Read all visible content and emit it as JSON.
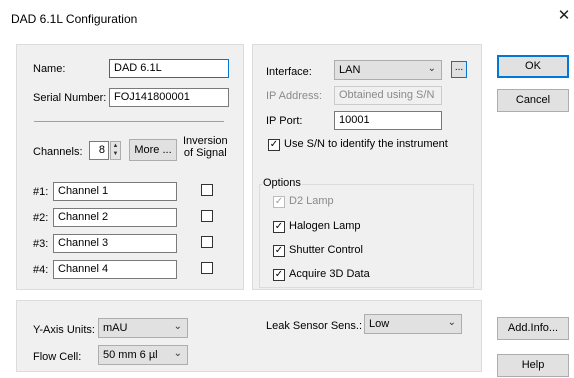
{
  "window": {
    "title": "DAD 6.1L Configuration"
  },
  "general": {
    "name_label": "Name:",
    "name_value": "DAD 6.1L",
    "serial_label": "Serial Number:",
    "serial_value": "FOJ141800001",
    "channels_label": "Channels:",
    "channels_value": "8",
    "more_button": "More ...",
    "inversion_header_line1": "Inversion",
    "inversion_header_line2": "of Signal",
    "channels": [
      {
        "label": "#1:",
        "value": "Channel 1",
        "inverted": false
      },
      {
        "label": "#2:",
        "value": "Channel 2",
        "inverted": false
      },
      {
        "label": "#3:",
        "value": "Channel 3",
        "inverted": false
      },
      {
        "label": "#4:",
        "value": "Channel 4",
        "inverted": false
      }
    ]
  },
  "connection": {
    "interface_label": "Interface:",
    "interface_value": "LAN",
    "browse_button": "...",
    "ip_address_label": "IP Address:",
    "ip_address_value": "Obtained using S/N",
    "ip_port_label": "IP Port:",
    "ip_port_value": "10001",
    "use_sn_label": "Use S/N to identify the instrument",
    "use_sn_checked": true
  },
  "options": {
    "group_label": "Options",
    "items": [
      {
        "label": "D2 Lamp",
        "checked": true,
        "enabled": false
      },
      {
        "label": "Halogen Lamp",
        "checked": true,
        "enabled": true
      },
      {
        "label": "Shutter Control",
        "checked": true,
        "enabled": true
      },
      {
        "label": "Acquire 3D Data",
        "checked": true,
        "enabled": true
      }
    ]
  },
  "bottom": {
    "y_axis_label": "Y-Axis Units:",
    "y_axis_value": "mAU",
    "flow_cell_label": "Flow Cell:",
    "flow_cell_value": "50 mm 6 µl",
    "leak_label": "Leak Sensor Sens.:",
    "leak_value": "Low"
  },
  "buttons": {
    "ok": "OK",
    "cancel": "Cancel",
    "add_info": "Add.Info...",
    "help": "Help"
  },
  "glyphs": {
    "close": "✕",
    "check": "✓",
    "chevron": "⌄",
    "spin_up": "▲",
    "spin_down": "▼"
  }
}
